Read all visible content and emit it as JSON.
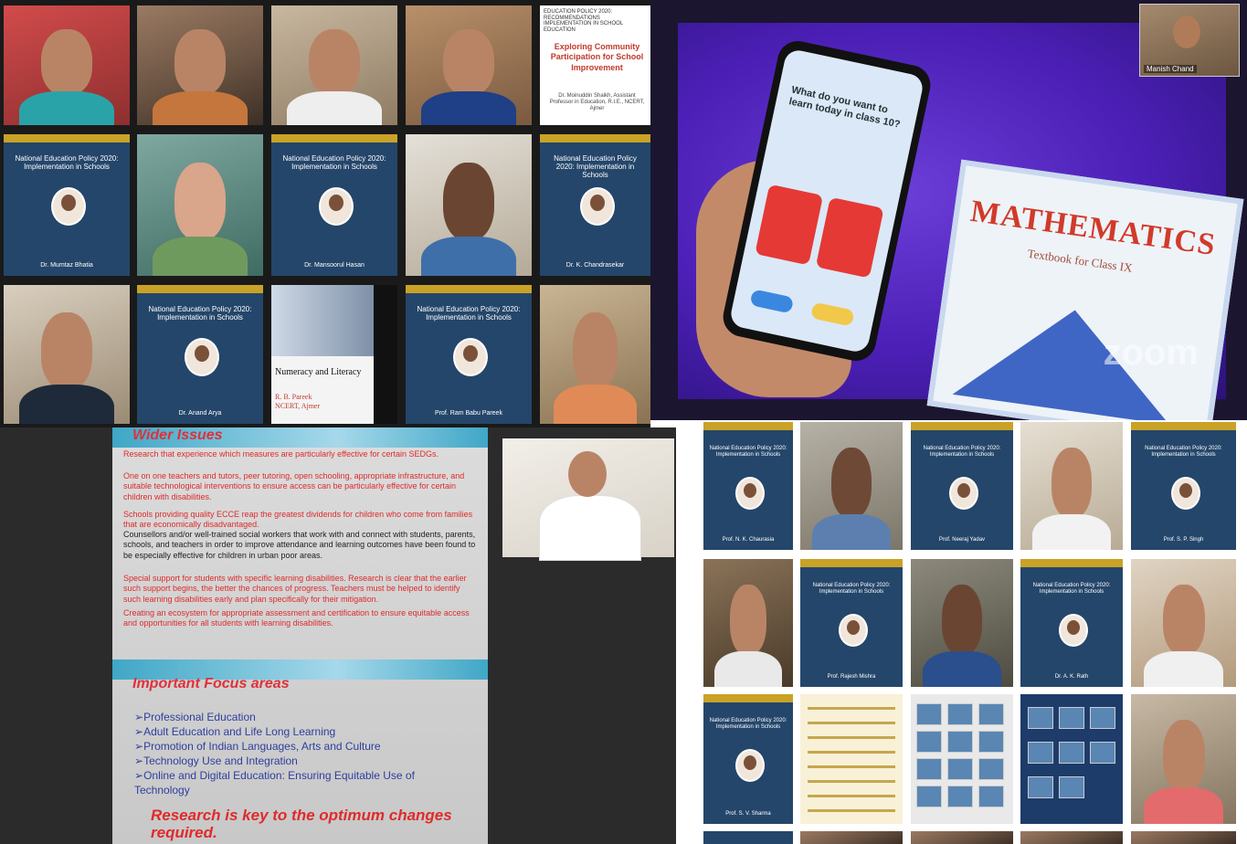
{
  "top_left_gallery": {
    "doc_tile": {
      "header": "EDUCATION POLICY 2020: RECOMMENDATIONS IMPLEMENTATION IN SCHOOL EDUCATION",
      "title": "Exploring Community Participation for School Improvement",
      "sub": "Dr. Moinuddin Shaikh, Assistant Professor in Education, R.I.E., NCERT, Ajmer"
    },
    "slide_title": "National Education Policy 2020: Implementation in Schools",
    "speakers": [
      "Dr. Mumtaz Bhatia",
      "Dr. Mansoorul Hasan",
      "Dr. K. Chandrasekar",
      "Dr. Anand Arya",
      "Prof. Ram Babu Pareek"
    ],
    "literacy_slide": {
      "title": "Numeracy and Literacy",
      "name": "R. B. Pareek",
      "org": "NCERT, Ajmer"
    }
  },
  "top_right": {
    "phone_question": "What do you want to learn today in class 10?",
    "book_title": "MATHEMATICS",
    "book_subtitle": "Textbook for Class IX",
    "watermark": "zoom",
    "pip_name": "Manish Chand"
  },
  "bottom_left_slide": {
    "heading1": "Wider Issues",
    "bullets": [
      {
        "text": "Research that experience which measures are particularly effective for certain SEDGs.",
        "color": "red"
      },
      {
        "text": "One on one teachers and tutors, peer tutoring, open schooling, appropriate infrastructure, and suitable technological interventions to ensure access can be particularly effective for certain children with disabilities.",
        "color": "red"
      },
      {
        "text": "Schools providing quality ECCE reap the greatest dividends for children who come from families that are economically disadvantaged.",
        "color": "red"
      },
      {
        "text": "Counsellors and/or well-trained social workers that work with and connect with students, parents, schools, and teachers in order to improve attendance and learning outcomes have been found to be especially effective for children in urban poor areas.",
        "color": "black"
      },
      {
        "text": "Special support for students with specific learning disabilities. Research is clear that the earlier such support begins, the better the chances of progress. Teachers must be helped to identify such learning disabilities early and plan specifically for their mitigation.",
        "color": "red"
      },
      {
        "text": "Creating an ecosystem for appropriate assessment and certification to ensure equitable access and opportunities for all students with learning disabilities.",
        "color": "red"
      }
    ],
    "heading2": "Important Focus areas",
    "focus_items": [
      "Professional Education",
      "Adult Education and Life Long Learning",
      "Promotion of Indian Languages, Arts and Culture",
      "Technology Use and Integration",
      "Online and Digital Education: Ensuring Equitable Use of Technology"
    ],
    "closing": "Research is key to the optimum changes required."
  },
  "bottom_right_gallery": {
    "slide_title": "National Education Policy 2020: Implementation in Schools",
    "speakers": [
      "Prof. N. K. Chaurasia",
      "Prof. Neeraj Yadav",
      "Prof. S. P. Singh",
      "Prof. Rajesh Mishra",
      "Dr. A. K. Rath",
      "Prof. S. V. Sharma"
    ]
  },
  "colors": {
    "slide_navy": "#24466a",
    "accent_gold": "#c9a227",
    "zoom_purple": "#4b1fb5",
    "alert_red": "#e02a2a"
  }
}
